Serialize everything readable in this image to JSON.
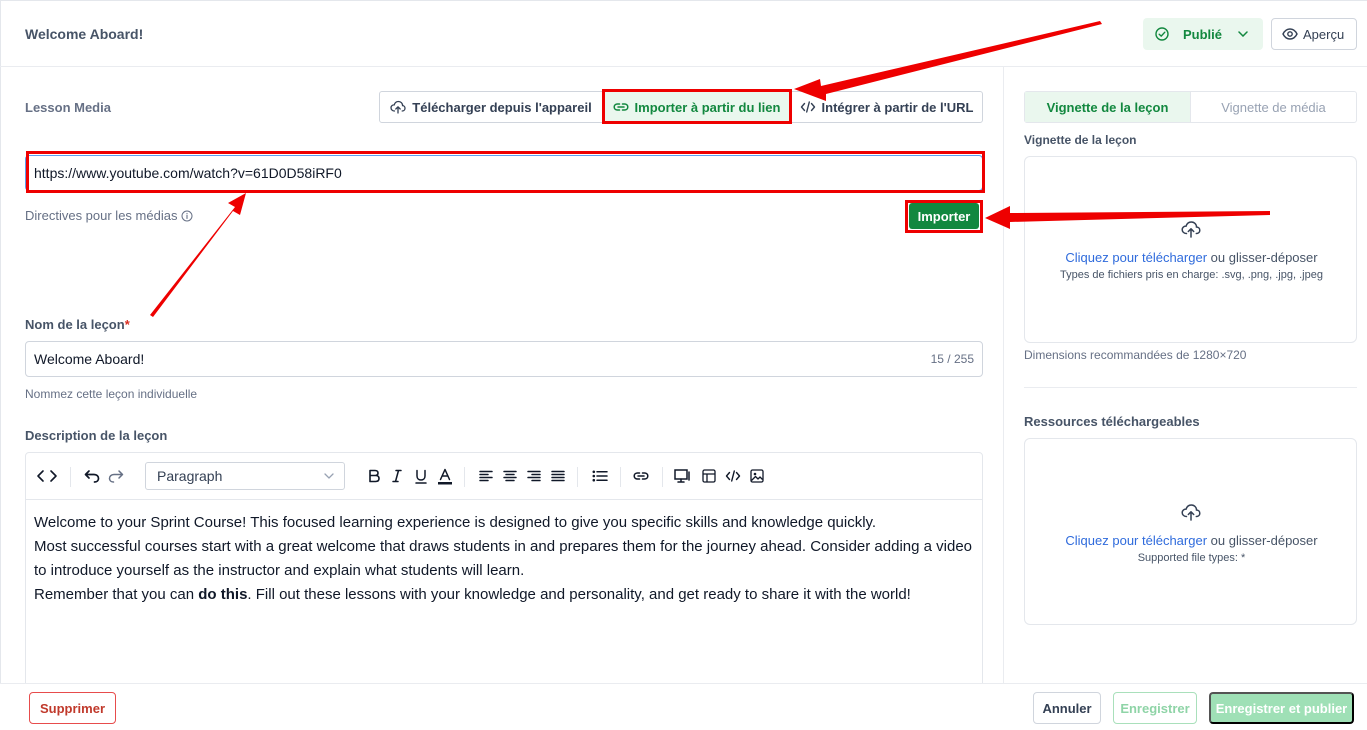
{
  "header": {
    "title": "Welcome Aboard!",
    "status_label": "Publié",
    "preview_label": "Aperçu"
  },
  "media": {
    "section_label": "Lesson Media",
    "tabs": [
      {
        "label": "Télécharger depuis l'appareil",
        "icon": "cloud-upload-icon"
      },
      {
        "label": "Importer à partir du lien",
        "icon": "link-icon"
      },
      {
        "label": "Intégrer à partir de l'URL",
        "icon": "code-icon"
      }
    ],
    "url_value": "https://www.youtube.com/watch?v=61D0D58iRF0",
    "guidelines_label": "Directives pour les médias",
    "import_label": "Importer"
  },
  "lesson_name": {
    "label": "Nom de la leçon",
    "required_mark": "*",
    "value": "Welcome Aboard!",
    "counter": "15 / 255",
    "hint": "Nommez cette leçon individuelle"
  },
  "description": {
    "label": "Description de la leçon",
    "block_format": "Paragraph",
    "toolbar_icons": [
      "code-view-icon",
      "undo-icon",
      "redo-icon",
      "bold-icon",
      "italic-icon",
      "underline-icon",
      "text-color-icon",
      "align-left-icon",
      "align-center-icon",
      "align-right-icon",
      "align-justify-icon",
      "bullet-list-icon",
      "link-icon",
      "embed-media-icon",
      "table-icon",
      "html-code-icon",
      "image-icon"
    ],
    "paragraph_1": "Welcome to your Sprint Course! This focused learning experience is designed to give you specific skills and knowledge quickly.",
    "paragraph_2": "Most successful courses start with a great welcome that draws students in and prepares them for the journey ahead. Consider adding a video to introduce yourself as the instructor and explain what students will learn.",
    "paragraph_3_before": "Remember that you can ",
    "paragraph_3_bold": "do this",
    "paragraph_3_after": ". Fill out these lessons with your knowledge and personality, and get ready to share it with the world!"
  },
  "thumbnail": {
    "tabs": [
      "Vignette de la leçon",
      "Vignette de média"
    ],
    "label": "Vignette de la leçon",
    "upload_link": "Cliquez pour télécharger",
    "upload_rest": " ou glisser-déposer",
    "types": "Types de fichiers pris en charge: .svg, .png, .jpg, .jpeg",
    "dimensions": "Dimensions recommandées de 1280×720"
  },
  "resources": {
    "label": "Ressources téléchargeables",
    "upload_link": "Cliquez pour télécharger",
    "upload_rest": " ou glisser-déposer",
    "types": "Supported file types: *"
  },
  "footer": {
    "delete_label": "Supprimer",
    "cancel_label": "Annuler",
    "save_label": "Enregistrer",
    "save_publish_label": "Enregistrer et publier"
  },
  "colors": {
    "brand_green": "#12883f",
    "annotation_red": "#ee0000",
    "link_blue": "#2f6bdc"
  }
}
